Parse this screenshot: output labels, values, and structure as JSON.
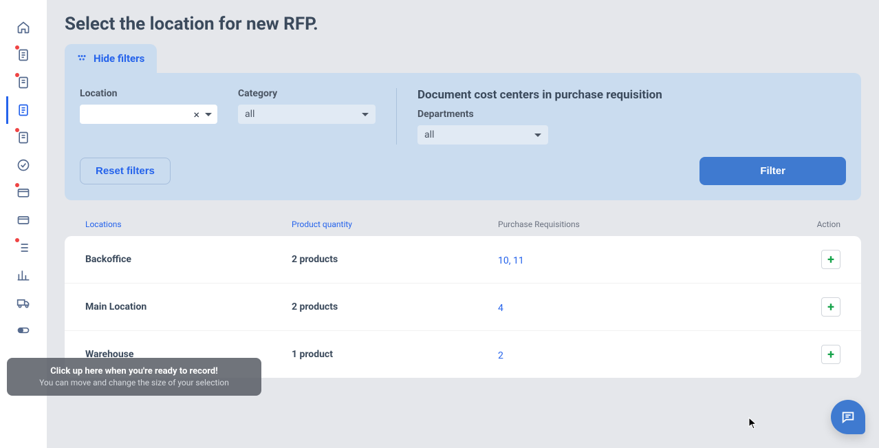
{
  "page_title": "Select the location for new RFP.",
  "filters": {
    "toggle_label": "Hide filters",
    "location_label": "Location",
    "category_label": "Category",
    "category_value": "all",
    "cost_section_title": "Document cost centers in purchase requisition",
    "departments_label": "Departments",
    "departments_value": "all",
    "reset_label": "Reset filters",
    "filter_label": "Filter"
  },
  "table": {
    "headers": {
      "locations": "Locations",
      "quantity": "Product quantity",
      "pr": "Purchase Requisitions",
      "action": "Action"
    },
    "rows": [
      {
        "location": "Backoffice",
        "quantity": "2 products",
        "pr": "10, 11"
      },
      {
        "location": "Main Location",
        "quantity": "2 products",
        "pr": "4"
      },
      {
        "location": "Warehouse",
        "quantity": "1 product",
        "pr": "2"
      }
    ]
  },
  "hint": {
    "line1": "Click up here when you're ready to record!",
    "line2": "You can move and change the size of your selection"
  }
}
